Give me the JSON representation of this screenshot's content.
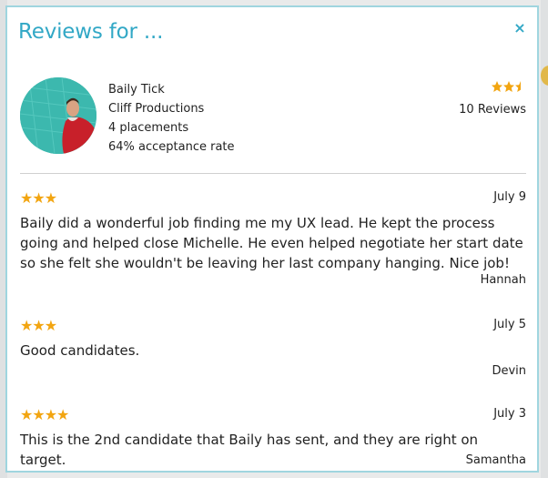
{
  "modal": {
    "title": "Reviews for ...",
    "close_icon": "×"
  },
  "profile": {
    "name": "Baily Tick",
    "company": "Cliff Productions",
    "placements": "4 placements",
    "acceptance": "64% acceptance rate",
    "rating": 2.5,
    "stars_display": "★★⯪",
    "review_count": "10 Reviews"
  },
  "reviews": [
    {
      "stars": 3,
      "stars_display": "★★★",
      "date": "July 9",
      "text": "Baily did a wonderful job finding me my UX lead. He kept the process going and helped close Michelle. He even helped negotiate her start date so she felt she wouldn't be leaving her last company hanging. Nice job!",
      "author": "Hannah"
    },
    {
      "stars": 3,
      "stars_display": "★★★",
      "date": "July 5",
      "text": "Good candidates.",
      "author": "Devin"
    },
    {
      "stars": 4,
      "stars_display": "★★★★",
      "date": "July 3",
      "text": "This is the 2nd candidate that Baily has sent, and they are right on target.",
      "author": "Samantha"
    }
  ],
  "colors": {
    "accent": "#32a8c6",
    "star": "#f2a511",
    "border": "#9fd5df"
  }
}
